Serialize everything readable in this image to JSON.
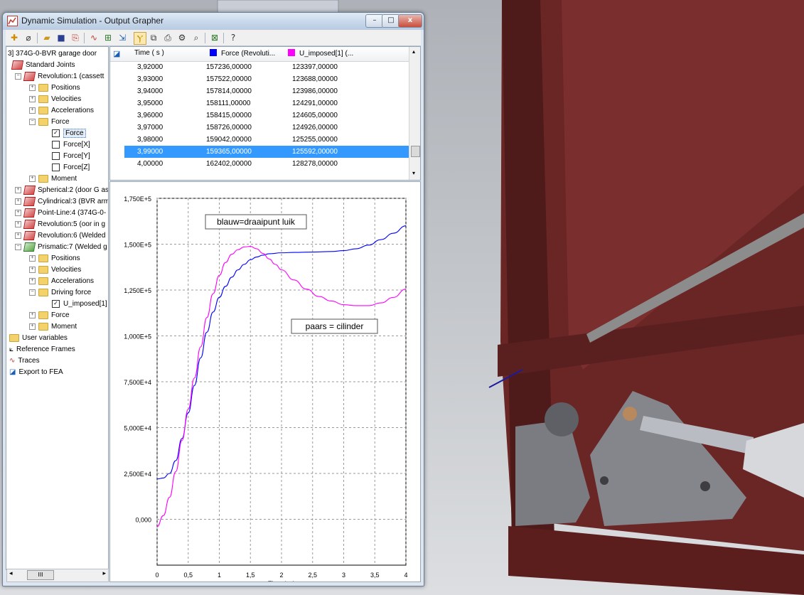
{
  "window": {
    "title": "Dynamic Simulation - Output Grapher",
    "minimize_label": "–",
    "maximize_label": "□",
    "close_label": "x"
  },
  "toolbar": {
    "icons": [
      "new-icon",
      "erase-icon",
      "open-folder-icon",
      "save-icon",
      "export-icon",
      "trace-icon",
      "grid-icon",
      "import-icon",
      "curve-icon",
      "copy-icon",
      "print-icon",
      "settings-icon",
      "zoom-icon",
      "excel-icon",
      "help-icon"
    ]
  },
  "tree": {
    "items": [
      {
        "label": "3] 374G-0-BVR garage door"
      },
      {
        "label": "Standard Joints"
      },
      {
        "label": "Revolution:1 (cassett"
      },
      {
        "label": "Positions"
      },
      {
        "label": "Velocities"
      },
      {
        "label": "Accelerations"
      },
      {
        "label": "Force"
      },
      {
        "label": "Force",
        "checked": true,
        "selected": true
      },
      {
        "label": "Force[X]",
        "checked": false
      },
      {
        "label": "Force[Y]",
        "checked": false
      },
      {
        "label": "Force[Z]",
        "checked": false
      },
      {
        "label": "Moment"
      },
      {
        "label": "Spherical:2 (door G as"
      },
      {
        "label": "Cylindrical:3 (BVR arm"
      },
      {
        "label": "Point-Line:4 (374G-0-"
      },
      {
        "label": "Revolution:5 (oor in g"
      },
      {
        "label": "Revolution:6 (Welded"
      },
      {
        "label": "Prismatic:7 (Welded g"
      },
      {
        "label": "Positions"
      },
      {
        "label": "Velocities"
      },
      {
        "label": "Accelerations"
      },
      {
        "label": "Driving force"
      },
      {
        "label": "U_imposed[1]",
        "checked": true
      },
      {
        "label": "Force"
      },
      {
        "label": "Moment"
      },
      {
        "label": "User variables"
      },
      {
        "label": "Reference Frames"
      },
      {
        "label": "Traces"
      },
      {
        "label": "Export to FEA"
      }
    ],
    "scroll_thumb_label": "III"
  },
  "table": {
    "columns": [
      "Time ( s )",
      "Force (Revoluti...",
      "U_imposed[1] (..."
    ],
    "column_colors": [
      "#0000ff",
      "#ff00ff"
    ],
    "rows": [
      [
        "3,92000",
        "157236,00000",
        "123397,00000"
      ],
      [
        "3,93000",
        "157522,00000",
        "123688,00000"
      ],
      [
        "3,94000",
        "157814,00000",
        "123986,00000"
      ],
      [
        "3,95000",
        "158111,00000",
        "124291,00000"
      ],
      [
        "3,96000",
        "158415,00000",
        "124605,00000"
      ],
      [
        "3,97000",
        "158726,00000",
        "124926,00000"
      ],
      [
        "3,98000",
        "159042,00000",
        "125255,00000"
      ],
      [
        "3,99000",
        "159365,00000",
        "125592,00000"
      ],
      [
        "4,00000",
        "162402,00000",
        "128278,00000"
      ]
    ],
    "selected_row": 7
  },
  "chart_data": {
    "type": "line",
    "xlabel": "Time ( s )",
    "ylabel": "",
    "xlim": [
      0,
      4
    ],
    "ylim": [
      -25000,
      175000
    ],
    "x_ticks": [
      "0",
      "0,5",
      "1",
      "1,5",
      "2",
      "2,5",
      "3",
      "3,5",
      "4"
    ],
    "y_ticks": [
      "0,000",
      "2,500E+4",
      "5,000E+4",
      "7,500E+4",
      "1,000E+5",
      "1,250E+5",
      "1,500E+5",
      "1,750E+5"
    ],
    "grid": true,
    "annotations": [
      "blauw=draaipunt luik",
      "paars = cilinder"
    ],
    "series": [
      {
        "color": "#0000ff",
        "x": [
          0,
          0.1,
          0.2,
          0.3,
          0.4,
          0.5,
          0.6,
          0.7,
          0.8,
          0.9,
          1.0,
          1.1,
          1.2,
          1.3,
          1.4,
          1.5,
          1.6,
          1.7,
          1.8,
          2.0,
          2.2,
          2.5,
          2.8,
          3.0,
          3.2,
          3.4,
          3.6,
          3.8,
          4.0
        ],
        "y": [
          22000,
          22500,
          25000,
          32000,
          44000,
          58000,
          73000,
          88000,
          102000,
          113000,
          121000,
          127000,
          132000,
          136000,
          139000,
          141500,
          143000,
          144000,
          144800,
          145300,
          145500,
          145700,
          146000,
          146500,
          147500,
          149500,
          152500,
          156000,
          160000
        ]
      },
      {
        "color": "#ff00ff",
        "x": [
          0,
          0.1,
          0.2,
          0.3,
          0.4,
          0.5,
          0.6,
          0.7,
          0.8,
          0.9,
          1.0,
          1.1,
          1.2,
          1.3,
          1.4,
          1.5,
          1.6,
          1.7,
          1.8,
          1.9,
          2.0,
          2.2,
          2.4,
          2.6,
          2.8,
          3.0,
          3.2,
          3.4,
          3.6,
          3.8,
          4.0
        ],
        "y": [
          -4000,
          2000,
          12000,
          26000,
          43000,
          60000,
          77000,
          94000,
          110000,
          123000,
          133000,
          140000,
          144500,
          147000,
          148500,
          148800,
          147500,
          145000,
          142000,
          139000,
          136000,
          130500,
          125500,
          121500,
          119000,
          117000,
          116500,
          116500,
          118000,
          121000,
          125500
        ]
      }
    ]
  }
}
